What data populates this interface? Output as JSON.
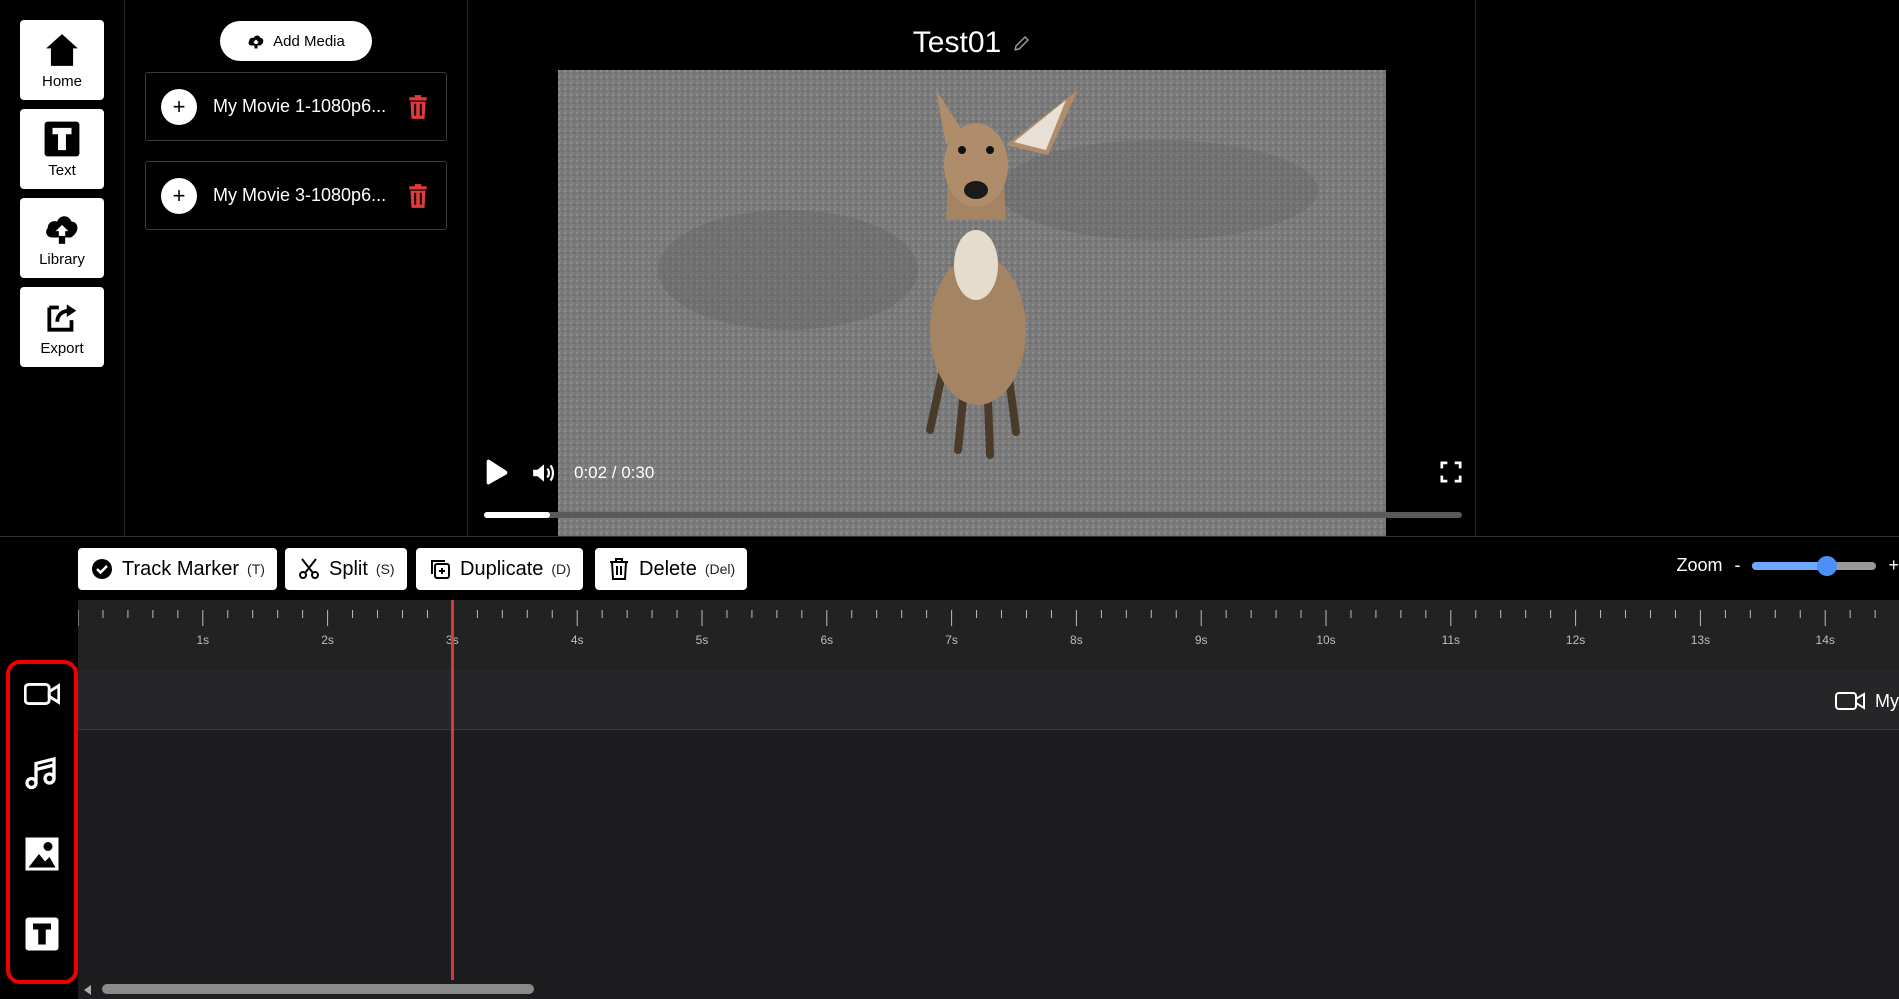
{
  "sidebar": {
    "items": [
      {
        "label": "Home",
        "icon": "home-icon"
      },
      {
        "label": "Text",
        "icon": "text-icon"
      },
      {
        "label": "Library",
        "icon": "cloud-upload-icon"
      },
      {
        "label": "Export",
        "icon": "export-icon"
      }
    ]
  },
  "media": {
    "add_label": "Add Media",
    "items": [
      {
        "name": "My Movie 1-1080p6..."
      },
      {
        "name": "My Movie 3-1080p6..."
      }
    ]
  },
  "project": {
    "title": "Test01"
  },
  "player": {
    "time": "0:02 / 0:30",
    "progress_fraction": 0.067
  },
  "toolbar": {
    "track_marker": {
      "label": "Track Marker",
      "key": "(T)"
    },
    "split": {
      "label": "Split",
      "key": "(S)"
    },
    "duplicate": {
      "label": "Duplicate",
      "key": "(D)"
    },
    "delete": {
      "label": "Delete",
      "key": "(Del)"
    },
    "zoom_label": "Zoom",
    "zoom_minus": "-",
    "zoom_plus": "+",
    "zoom_fraction": 0.6
  },
  "timeline": {
    "ticks": [
      "1s",
      "2s",
      "3s",
      "4s",
      "5s",
      "6s",
      "7s",
      "8s",
      "9s",
      "10s",
      "11s",
      "12s",
      "13s",
      "14s"
    ],
    "clip_label": "My",
    "playhead_seconds": 3
  },
  "track_types": [
    "video-track-icon",
    "audio-track-icon",
    "image-track-icon",
    "text-track-icon"
  ],
  "colors": {
    "delete_red": "#e03a3a",
    "playhead_red": "#d9363e",
    "highlight_red": "#ee0000",
    "zoom_blue": "#4d8ff6"
  }
}
